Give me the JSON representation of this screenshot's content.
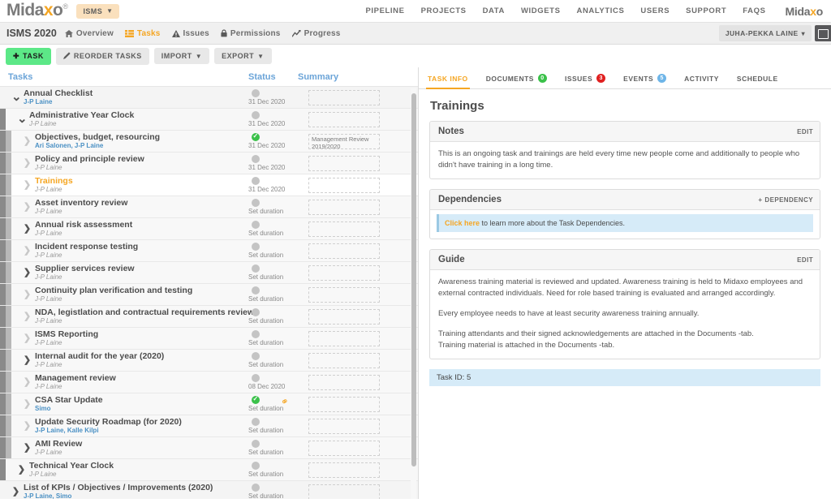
{
  "topbar": {
    "logo": "Midaxo",
    "logo_reg": "®",
    "workspace_pill": "ISMS",
    "nav": [
      {
        "label": "PIPELINE"
      },
      {
        "label": "PROJECTS"
      },
      {
        "label": "DATA"
      },
      {
        "label": "WIDGETS"
      },
      {
        "label": "ANALYTICS"
      },
      {
        "label": "USERS"
      },
      {
        "label": "SUPPORT"
      },
      {
        "label": "FAQS"
      }
    ],
    "brand_mini": "Midaxo"
  },
  "subbar": {
    "project_title": "ISMS 2020",
    "items": [
      {
        "label": "Overview",
        "icon": "home-icon",
        "active": false
      },
      {
        "label": "Tasks",
        "icon": "tasks-icon",
        "active": true
      },
      {
        "label": "Issues",
        "icon": "warning-icon",
        "active": false
      },
      {
        "label": "Permissions",
        "icon": "lock-icon",
        "active": false
      },
      {
        "label": "Progress",
        "icon": "chart-icon",
        "active": false
      }
    ],
    "user_name": "JUHA-PEKKA LAINE"
  },
  "toolbar": {
    "add_task": "TASK",
    "reorder": "REORDER TASKS",
    "import": "IMPORT",
    "export": "EXPORT"
  },
  "task_list": {
    "columns": {
      "tasks": "Tasks",
      "status": "Status",
      "summary": "Summary"
    },
    "rows": [
      {
        "name": "Annual Checklist",
        "owner": "J-P Laine",
        "owner_style": "link",
        "level": 0,
        "arrow": "down",
        "status": "pending",
        "status_label": "31 Dec 2020",
        "summary": "",
        "selected": false,
        "dependency": false
      },
      {
        "name": "Administrative Year Clock",
        "owner": "J-P Laine",
        "owner_style": "plain",
        "level": 1,
        "arrow": "down",
        "status": "pending",
        "status_label": "31 Dec 2020",
        "summary": "",
        "selected": false,
        "dependency": false
      },
      {
        "name": "Objectives, budget, resourcing",
        "owner": "Ari Salonen, J-P Laine",
        "owner_style": "link",
        "level": 2,
        "arrow": "right-light",
        "status": "done",
        "status_label": "31 Dec 2020",
        "summary": "Management Review 2019/2020",
        "selected": false,
        "dependency": false
      },
      {
        "name": "Policy and principle review",
        "owner": "J-P Laine",
        "owner_style": "plain",
        "level": 2,
        "arrow": "right-light",
        "status": "pending",
        "status_label": "31 Dec 2020",
        "summary": "",
        "selected": false,
        "dependency": false
      },
      {
        "name": "Trainings",
        "owner": "J-P Laine",
        "owner_style": "plain",
        "level": 2,
        "arrow": "right-light",
        "status": "pending",
        "status_label": "31 Dec 2020",
        "summary": "",
        "selected": true,
        "dependency": false
      },
      {
        "name": "Asset inventory review",
        "owner": "J-P Laine",
        "owner_style": "plain",
        "level": 2,
        "arrow": "right-light",
        "status": "pending",
        "status_label": "Set duration",
        "summary": "",
        "selected": false,
        "dependency": false
      },
      {
        "name": "Annual risk assessment",
        "owner": "J-P Laine",
        "owner_style": "plain",
        "level": 2,
        "arrow": "right-strong",
        "status": "pending",
        "status_label": "Set duration",
        "summary": "",
        "selected": false,
        "dependency": false
      },
      {
        "name": "Incident response testing",
        "owner": "J-P Laine",
        "owner_style": "plain",
        "level": 2,
        "arrow": "right-light",
        "status": "pending",
        "status_label": "Set duration",
        "summary": "",
        "selected": false,
        "dependency": false
      },
      {
        "name": "Supplier services review",
        "owner": "J-P Laine",
        "owner_style": "plain",
        "level": 2,
        "arrow": "right-strong",
        "status": "pending",
        "status_label": "Set duration",
        "summary": "",
        "selected": false,
        "dependency": false
      },
      {
        "name": "Continuity plan verification and testing",
        "owner": "J-P Laine",
        "owner_style": "plain",
        "level": 2,
        "arrow": "right-light",
        "status": "pending",
        "status_label": "Set duration",
        "summary": "",
        "selected": false,
        "dependency": false
      },
      {
        "name": "NDA, legistlation and contractual requirements review",
        "owner": "J-P Laine",
        "owner_style": "plain",
        "level": 2,
        "arrow": "right-light",
        "status": "pending",
        "status_label": "Set duration",
        "summary": "",
        "selected": false,
        "dependency": false
      },
      {
        "name": "ISMS Reporting",
        "owner": "J-P Laine",
        "owner_style": "plain",
        "level": 2,
        "arrow": "right-light",
        "status": "pending",
        "status_label": "Set duration",
        "summary": "",
        "selected": false,
        "dependency": false
      },
      {
        "name": "Internal audit for the year (2020)",
        "owner": "J-P Laine",
        "owner_style": "plain",
        "level": 2,
        "arrow": "right-strong",
        "status": "pending",
        "status_label": "Set duration",
        "summary": "",
        "selected": false,
        "dependency": false
      },
      {
        "name": "Management review",
        "owner": "J-P Laine",
        "owner_style": "plain",
        "level": 2,
        "arrow": "right-light",
        "status": "pending",
        "status_label": "08 Dec 2020",
        "summary": "",
        "selected": false,
        "dependency": false
      },
      {
        "name": "CSA Star Update",
        "owner": "Simo",
        "owner_style": "link",
        "level": 2,
        "arrow": "right-light",
        "status": "done",
        "status_label": "Set duration",
        "summary": "",
        "selected": false,
        "dependency": true
      },
      {
        "name": "Update Security Roadmap (for 2020)",
        "owner": "J-P Laine, Kalle Kilpi",
        "owner_style": "link",
        "level": 2,
        "arrow": "right-light",
        "status": "pending",
        "status_label": "Set duration",
        "summary": "",
        "selected": false,
        "dependency": false
      },
      {
        "name": "AMI Review",
        "owner": "J-P Laine",
        "owner_style": "plain",
        "level": 2,
        "arrow": "right-strong",
        "status": "pending",
        "status_label": "Set duration",
        "summary": "",
        "selected": false,
        "dependency": false
      },
      {
        "name": "Technical Year Clock",
        "owner": "J-P Laine",
        "owner_style": "plain",
        "level": 1,
        "arrow": "right-strong",
        "status": "pending",
        "status_label": "Set duration",
        "summary": "",
        "selected": false,
        "dependency": false
      },
      {
        "name": "List of KPIs / Objectives / Improvements (2020)",
        "owner": "J-P Laine, Simo",
        "owner_style": "link",
        "level": 0,
        "arrow": "right-strong",
        "status": "pending",
        "status_label": "Set duration",
        "summary": "",
        "selected": false,
        "dependency": false
      }
    ]
  },
  "detail": {
    "tabs": [
      {
        "label": "TASK INFO",
        "badge": null,
        "badge_color": null,
        "active": true
      },
      {
        "label": "DOCUMENTS",
        "badge": "0",
        "badge_color": "g",
        "active": false
      },
      {
        "label": "ISSUES",
        "badge": "3",
        "badge_color": "r",
        "active": false
      },
      {
        "label": "EVENTS",
        "badge": "5",
        "badge_color": "b",
        "active": false
      },
      {
        "label": "ACTIVITY",
        "badge": null,
        "badge_color": null,
        "active": false
      },
      {
        "label": "SCHEDULE",
        "badge": null,
        "badge_color": null,
        "active": false
      }
    ],
    "title": "Trainings",
    "notes": {
      "heading": "Notes",
      "action": "EDIT",
      "text": "This is an ongoing task and trainings are held every time new people come and additionally to people who didn't have training in a long time."
    },
    "dependencies": {
      "heading": "Dependencies",
      "action": "DEPENDENCY",
      "action_plus": "+",
      "info_link": "Click here",
      "info_rest": " to learn more about the Task Dependencies."
    },
    "guide": {
      "heading": "Guide",
      "action": "EDIT",
      "paragraphs": [
        "Awareness training material is reviewed and updated. Awareness training is held to Midaxo employees and external contracted individuals. Need for role based training is evaluated and arranged accordingly.",
        "Every employee needs to have at least security awareness training annually.",
        "Training attendants and their signed acknowledgements are attached in the Documents -tab.",
        "Training material is attached in the Documents -tab."
      ]
    },
    "task_id": "Task ID: 5"
  },
  "colors": {
    "accent": "#f5a623",
    "link": "#4a90c4",
    "done": "#3bc14a",
    "issue": "#e02020",
    "event": "#6eb5e8",
    "header_link": "#6ba4d8",
    "add_button": "#5ce887"
  }
}
